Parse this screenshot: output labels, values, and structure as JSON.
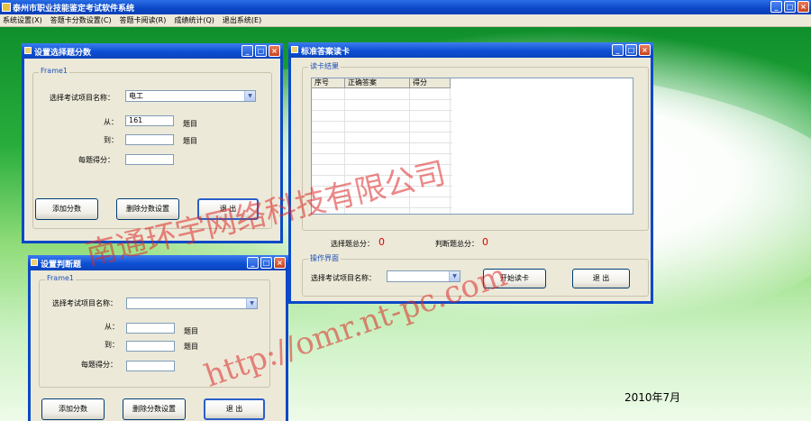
{
  "app": {
    "title": "泰州市职业技能鉴定考试软件系统",
    "menu": [
      "系统设置(X)",
      "答题卡分数设置(C)",
      "答题卡阅读(R)",
      "成绩统计(Q)",
      "退出系统(E)"
    ]
  },
  "caption_buttons": {
    "min": "_",
    "max": "□",
    "close": "×"
  },
  "win_select_score": {
    "title": "设置选择题分数",
    "frame_label": "Frame1",
    "project_label": "选择考试项目名称：",
    "project_value": "电工",
    "from_label": "从：",
    "from_value": "161",
    "to_label": "到：",
    "to_value": "",
    "unit_label": "题目",
    "score_label": "每题得分：",
    "score_value": "",
    "buttons": {
      "add": "添加分数",
      "delete": "删除分数设置",
      "exit": "退 出"
    }
  },
  "win_judge_score": {
    "title": "设置判断题",
    "frame_label": "Frame1",
    "project_label": "选择考试项目名称：",
    "project_value": "",
    "from_label": "从：",
    "to_label": "到：",
    "unit_label": "题目",
    "score_label": "每题得分：",
    "buttons": {
      "add": "添加分数",
      "delete": "删除分数设置",
      "exit": "退 出"
    }
  },
  "win_read_card": {
    "title": "标准答案读卡",
    "result_frame": "读卡结果",
    "grid_headers": [
      "序号",
      "正确答案",
      "得分"
    ],
    "choice_total_label": "选择题总分：",
    "choice_total_value": "0",
    "judge_total_label": "判断题总分：",
    "judge_total_value": "0",
    "op_frame": "操作界面",
    "project_label": "选择考试项目名称：",
    "project_value": "",
    "buttons": {
      "start": "开始读卡",
      "exit": "退 出"
    }
  },
  "desktop": {
    "date": "2010年7月"
  },
  "watermark": {
    "company": "南通环宇网络科技有限公司",
    "url": "http://omr.nt-pc.com"
  }
}
